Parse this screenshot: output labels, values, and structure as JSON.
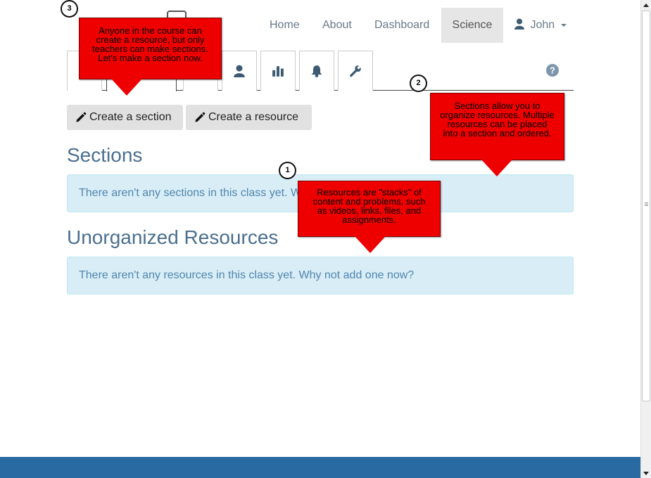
{
  "nav": {
    "home": "Home",
    "about": "About",
    "dashboard": "Dashboard",
    "science": "Science",
    "user": "John"
  },
  "toolbar": {
    "create_section": "Create a section",
    "create_resource": "Create a resource"
  },
  "sections": {
    "heading": "Sections",
    "empty": "There aren't any sections in this class yet. W"
  },
  "resources": {
    "heading": "Unorganized Resources",
    "empty": "There aren't any resources in this class yet. Why not add one now?"
  },
  "callouts": {
    "c1_num": "1",
    "c1_text": "Resources are \"stacks\" of content and problems, such as videos, links, files, and assignments.",
    "c2_num": "2",
    "c2_text": "Sections allow you to organize resources. Multiple resources can be placed into a section and ordered.",
    "c3_num": "3",
    "c3_text": "Anyone in the course can create a resource, but only teachers can make sections. Let's make a section now."
  },
  "colors": {
    "accent": "#4a6f8f",
    "callout": "#ee0000",
    "footer": "#2a6aa3",
    "alert_bg": "#d9edf7"
  },
  "icons": [
    "user-icon",
    "chart-icon",
    "bell-icon",
    "wrench-icon",
    "help-icon",
    "pencil-icon"
  ]
}
